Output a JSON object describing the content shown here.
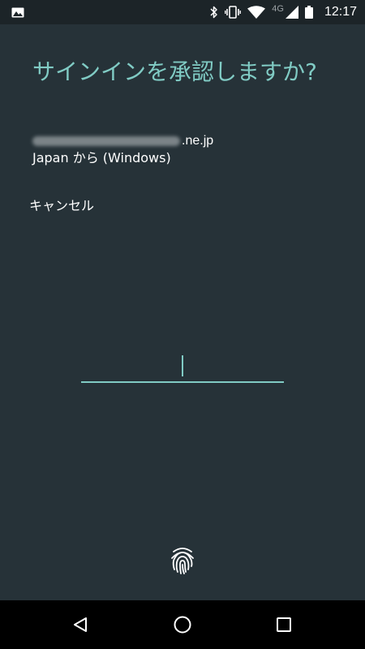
{
  "status_bar": {
    "left_icon": "image-icon",
    "icons": [
      "bluetooth-icon",
      "vibrate-icon",
      "wifi-icon",
      "cellular-signal-icon",
      "battery-icon"
    ],
    "network_type": "4G",
    "time": "12:17"
  },
  "dialog": {
    "title": "サインインを承認しますか?",
    "account_suffix": ".ne.jp",
    "location": "Japan から (Windows)",
    "cancel_label": "キャンセル",
    "code_value": "",
    "fingerprint_icon": "fingerprint-icon"
  },
  "nav_bar": {
    "icons": [
      "back-icon",
      "home-icon",
      "recents-icon"
    ]
  },
  "colors": {
    "background": "#263238",
    "status_bar": "#1c2428",
    "accent": "#80cbc4",
    "text": "#ffffff",
    "nav_bar": "#000000"
  }
}
